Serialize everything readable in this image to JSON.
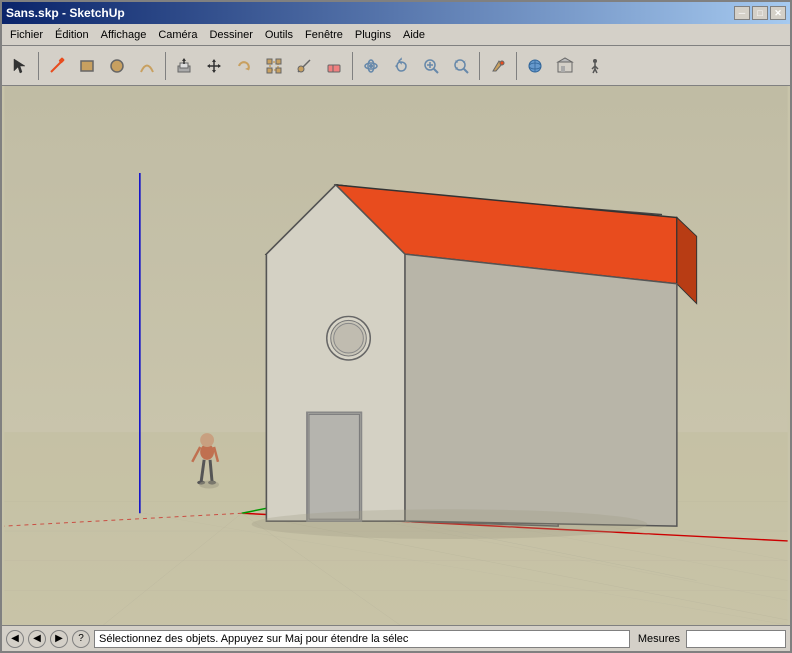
{
  "window": {
    "title": "Sans.skp - SketchUp"
  },
  "title_controls": {
    "minimize": "─",
    "maximize": "□",
    "close": "✕"
  },
  "menu": {
    "items": [
      "Fichier",
      "Édition",
      "Affichage",
      "Caméra",
      "Dessiner",
      "Outils",
      "Fenêtre",
      "Plugins",
      "Aide"
    ]
  },
  "toolbar": {
    "tools": [
      {
        "name": "select-tool",
        "icon": "↖",
        "label": "Sélection"
      },
      {
        "name": "separator-1",
        "icon": ""
      },
      {
        "name": "line-tool",
        "icon": "✏",
        "label": "Crayon"
      },
      {
        "name": "rect-tool",
        "icon": "▭",
        "label": "Rectangle"
      },
      {
        "name": "circle-tool",
        "icon": "○",
        "label": "Cercle"
      },
      {
        "name": "arc-tool",
        "icon": "◠",
        "label": "Arc"
      },
      {
        "name": "separator-2",
        "icon": ""
      },
      {
        "name": "push-pull-tool",
        "icon": "⬆",
        "label": "Pousser/Tirer"
      },
      {
        "name": "move-tool",
        "icon": "✦",
        "label": "Déplacer"
      },
      {
        "name": "rotate-tool",
        "icon": "↻",
        "label": "Pivoter"
      },
      {
        "name": "scale-tool",
        "icon": "⤢",
        "label": "Echelle"
      },
      {
        "name": "offset-tool",
        "icon": "⊡",
        "label": "Décaler"
      },
      {
        "name": "tape-tool",
        "icon": "📐",
        "label": "Mètre à ruban"
      },
      {
        "name": "separator-3",
        "icon": ""
      },
      {
        "name": "orbit-tool",
        "icon": "⟳",
        "label": "Orbite"
      },
      {
        "name": "pan-tool",
        "icon": "✋",
        "label": "Panoramique"
      },
      {
        "name": "zoom-tool",
        "icon": "🔍",
        "label": "Zoom"
      },
      {
        "name": "zoom-extend-tool",
        "icon": "⊕",
        "label": "Zoom étendu"
      },
      {
        "name": "separator-4",
        "icon": ""
      },
      {
        "name": "texture-tool",
        "icon": "🎨",
        "label": "Matériaux"
      },
      {
        "name": "separator-5",
        "icon": ""
      },
      {
        "name": "component-tool",
        "icon": "⚙",
        "label": "Composants"
      },
      {
        "name": "group-tool",
        "icon": "⬡",
        "label": "Groupe"
      }
    ]
  },
  "status": {
    "text": "Sélectionnez des objets. Appuyez sur Maj pour étendre la sélec",
    "measures_label": "Mesures",
    "measures_value": ""
  },
  "scene": {
    "background_color": "#c8c4aa",
    "axes": {
      "x_color": "#cc0000",
      "y_color": "#009900",
      "z_color": "#0000cc"
    },
    "house": {
      "roof_color": "#e84c1e",
      "wall_color": "#d0cdc0",
      "door_color": "#b0b0b0",
      "window_color": "#c0c0c0"
    }
  }
}
